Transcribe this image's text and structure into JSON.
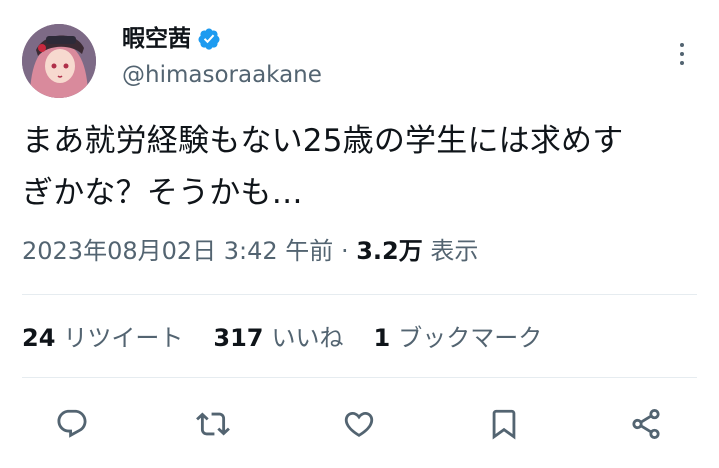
{
  "author": {
    "display_name": "暇空茜",
    "handle": "@himasoraakane",
    "verified": true
  },
  "tweet": {
    "text": "まあ就労経験もない25歳の学生には求めす\nぎかな？そうかも…",
    "timestamp": "2023年08月02日 3:42 午前",
    "separator": " · ",
    "views_count": "3.2万",
    "views_label": " 表示"
  },
  "stats": {
    "retweets_count": "24",
    "retweets_label": "リツイート",
    "likes_count": "317",
    "likes_label": "いいね",
    "bookmarks_count": "1",
    "bookmarks_label": "ブックマーク"
  },
  "icons": {
    "verified": "verified-badge-icon",
    "more": "more-vertical-icon",
    "reply": "reply-icon",
    "retweet": "retweet-icon",
    "like": "heart-icon",
    "bookmark": "bookmark-icon",
    "share": "share-icon"
  },
  "colors": {
    "verified_blue": "#1d9bf0",
    "secondary_text": "#536471",
    "primary_text": "#0f1419"
  }
}
